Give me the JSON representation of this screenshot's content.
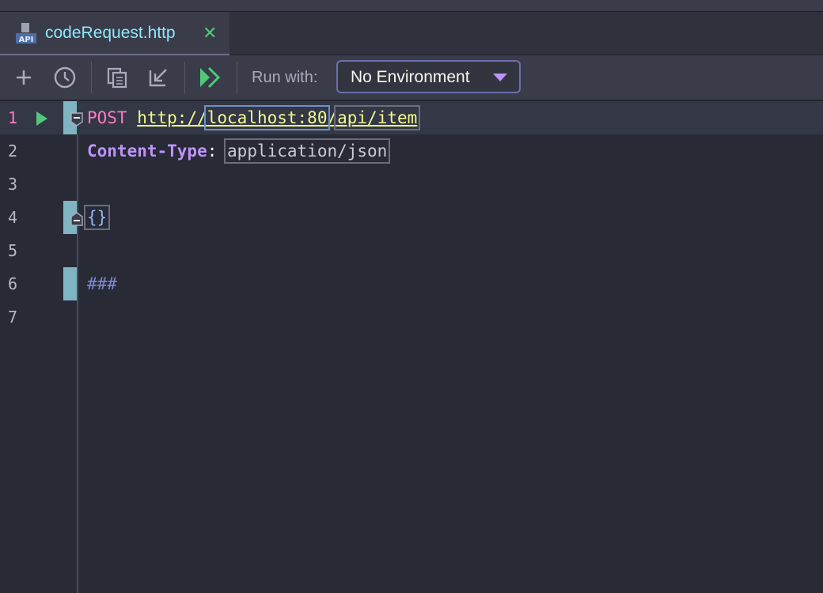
{
  "window": {
    "tab": {
      "title": "codeRequest.http",
      "icon_label": "API",
      "close": "✕"
    }
  },
  "toolbar": {
    "run_label": "Run with:",
    "environment": "No Environment"
  },
  "editor": {
    "line_numbers": [
      "1",
      "2",
      "3",
      "4",
      "5",
      "6",
      "7"
    ],
    "line1": {
      "method": "POST",
      "url_scheme": "http://",
      "url_host": "localhost:80",
      "url_sep": "/",
      "url_path": "api/item"
    },
    "line2": {
      "header_name": "Content-Type",
      "colon": ":",
      "header_value": "application/json"
    },
    "line4": {
      "body": "{}"
    },
    "line6": {
      "separator": "###"
    }
  },
  "colors": {
    "background": "#282a36",
    "method": "#ff79c6",
    "url": "#f1fa8c",
    "header": "#bd93f9",
    "run": "#50c878"
  }
}
